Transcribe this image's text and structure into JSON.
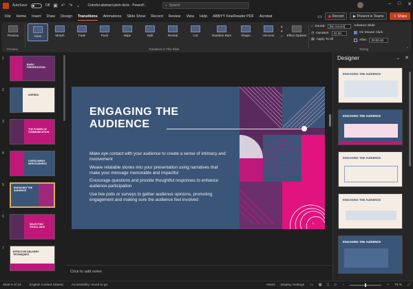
{
  "titlebar": {
    "autosave_label": "AutoSave",
    "autosave_state": "Off",
    "doc_title": "Colorful abstract pitch deck  ·  PowerP...",
    "search_placeholder": "Search"
  },
  "menu": {
    "tabs": [
      "File",
      "Home",
      "Insert",
      "Draw",
      "Design",
      "Transitions",
      "Animations",
      "Slide Show",
      "Record",
      "Review",
      "View",
      "Help",
      "ABBYY FineReader PDF",
      "Acrobat"
    ],
    "active": "Transitions",
    "record_label": "Record",
    "present_label": "Present in Teams",
    "share_label": "Share"
  },
  "ribbon": {
    "preview_label": "Preview",
    "preview_group": "Preview",
    "transitions": [
      "None",
      "Morph",
      "Fade",
      "Push",
      "Wipe",
      "Split",
      "Reveal",
      "Cut",
      "Random Bars",
      "Shape",
      "Uncover"
    ],
    "selected_transition": "None",
    "transitions_group": "Transition to This Slide",
    "effect_options_label": "Effect Options",
    "sound_label": "Sound:",
    "sound_value": "[No Sound]",
    "duration_label": "Duration:",
    "duration_value": "02.00",
    "apply_all_label": "Apply To All",
    "advance_label": "Advance Slide",
    "on_click_label": "On Mouse Click",
    "after_label": "After:",
    "after_value": "00:00.00",
    "timing_group": "Timing"
  },
  "thumbnails": [
    {
      "num": "1",
      "text": "BASIC PRESENTATION"
    },
    {
      "num": "2",
      "text": "AGENDA"
    },
    {
      "num": "3",
      "text": "THE POWER OF COMMUNICATION"
    },
    {
      "num": "4",
      "text": "OVERCOMING NERVOUSNESS"
    },
    {
      "num": "5",
      "text": "ENGAGING THE AUDIENCE"
    },
    {
      "num": "6",
      "text": "SELECTING VISUAL AIDS"
    },
    {
      "num": "7",
      "text": "EFFECTIVE DELIVERY TECHNIQUES"
    }
  ],
  "slide": {
    "title": "ENGAGING THE AUDIENCE",
    "bullets": [
      "Make eye contact with your audience to create a sense of intimacy and involvement",
      "Weave relatable stories into your presentation using narratives that make your message memorable and impactful",
      "Encourage questions and provide thoughtful responses to enhance audience participation",
      "Use live polls or surveys to gather audience opinions, promoting engagement and making sure the audience feel involved"
    ],
    "page_number": "5"
  },
  "notes_placeholder": "Click to add notes",
  "designer": {
    "title": "Designer",
    "card_title": "ENGAGING THE AUDIENCE"
  },
  "status": {
    "slide_info": "Slide 5 of 15",
    "language": "English (United States)",
    "accessibility": "Accessibility: Good to go",
    "notes_label": "Notes",
    "display_label": "Display Settings",
    "zoom": "76 %"
  },
  "colors": {
    "accent": "#c43e1c",
    "slide_blue": "#3b5578",
    "magenta": "#c0187a",
    "purple": "#5a2a5c"
  }
}
